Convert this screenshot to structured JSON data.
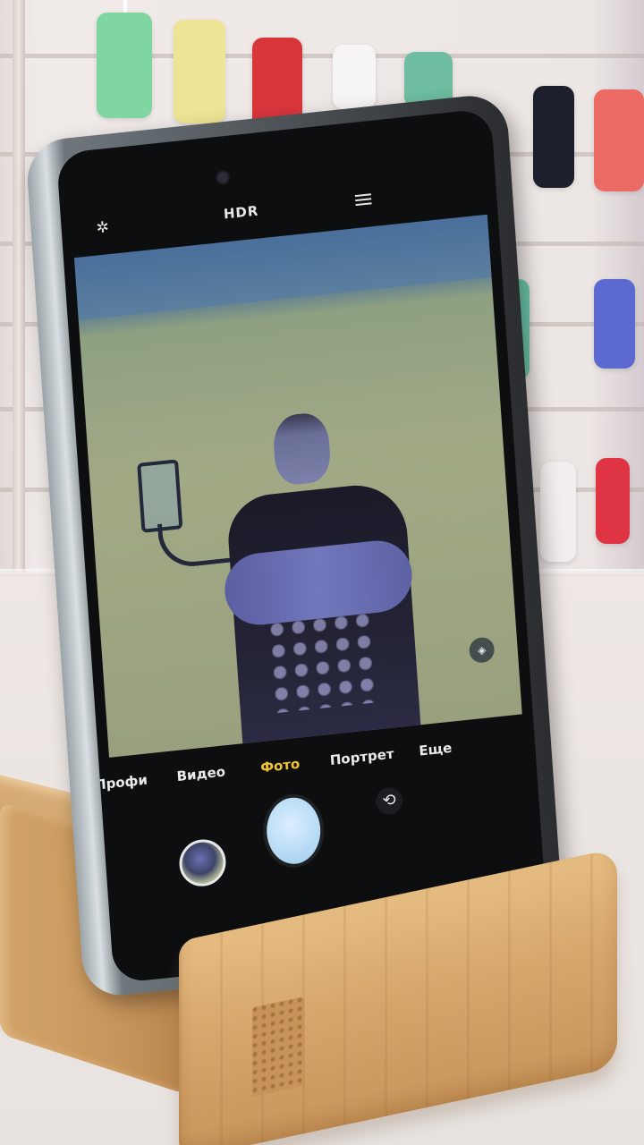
{
  "camera_app": {
    "top_bar": {
      "hdr_label": "HDR",
      "flash_icon": "flash-auto-icon",
      "menu_icon": "menu-icon"
    },
    "modes": [
      {
        "label": "Профи",
        "active": false
      },
      {
        "label": "Видео",
        "active": false
      },
      {
        "label": "Фото",
        "active": true
      },
      {
        "label": "Портрет",
        "active": false
      },
      {
        "label": "Еще",
        "active": false
      }
    ],
    "controls": {
      "gallery_icon": "gallery-thumbnail-icon",
      "shutter_icon": "shutter-icon",
      "switch_icon": "switch-camera-icon"
    },
    "colors": {
      "active_mode": "#f0c330",
      "shutter": "#b9dcf6"
    }
  }
}
